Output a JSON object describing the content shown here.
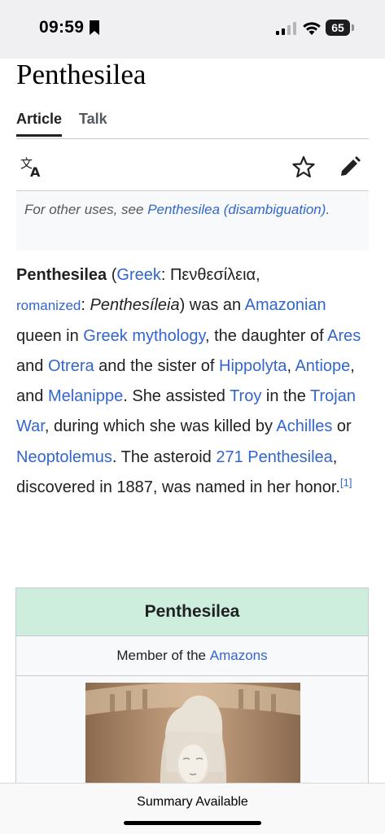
{
  "status": {
    "time": "09:59",
    "battery": "65"
  },
  "article": {
    "title": "Penthesilea",
    "tabs": [
      "Article",
      "Talk"
    ]
  },
  "hatnote": {
    "prefix": "For other uses, see ",
    "link": "Penthesilea (disambiguation)",
    "suffix": "."
  },
  "lead": {
    "name": "Penthesilea",
    "t1": " (",
    "l_greek": "Greek",
    "t2": ": Πενθεσίλεια,",
    "l_romanized": "romanized",
    "t3": ": ",
    "romanized_name": "Penthesíleia",
    "t4": ") was an ",
    "l_amazonian": "Amazonian",
    "t5": " queen in ",
    "l_greek_myth": "Greek mythology",
    "t6": ", the daughter of ",
    "l_ares": "Ares",
    "t7": " and ",
    "l_otrera": "Otrera",
    "t8": " and the sister of ",
    "l_hippolyta": "Hippolyta",
    "t9": ", ",
    "l_antiope": "Antiope",
    "t10": ", and ",
    "l_melanippe": "Melanippe",
    "t11": ". She assisted ",
    "l_troy": "Troy",
    "t12": " in the ",
    "l_trojan_war": "Trojan War",
    "t13": ", during which she was killed by ",
    "l_achilles": "Achilles",
    "t14": " or ",
    "l_neoptolemus": "Neoptolemus",
    "t15": ". The asteroid ",
    "l_asteroid": "271 Penthesilea",
    "t16": ", discovered in 1887, was named in her honor.",
    "ref": "[1]"
  },
  "infobox": {
    "title": "Penthesilea",
    "subtitle_prefix": "Member of the ",
    "subtitle_link": "Amazons"
  },
  "bottom": {
    "summary": "Summary Available"
  },
  "colors": {
    "link": "#3366cc",
    "infobox_header": "#cdeedd"
  }
}
